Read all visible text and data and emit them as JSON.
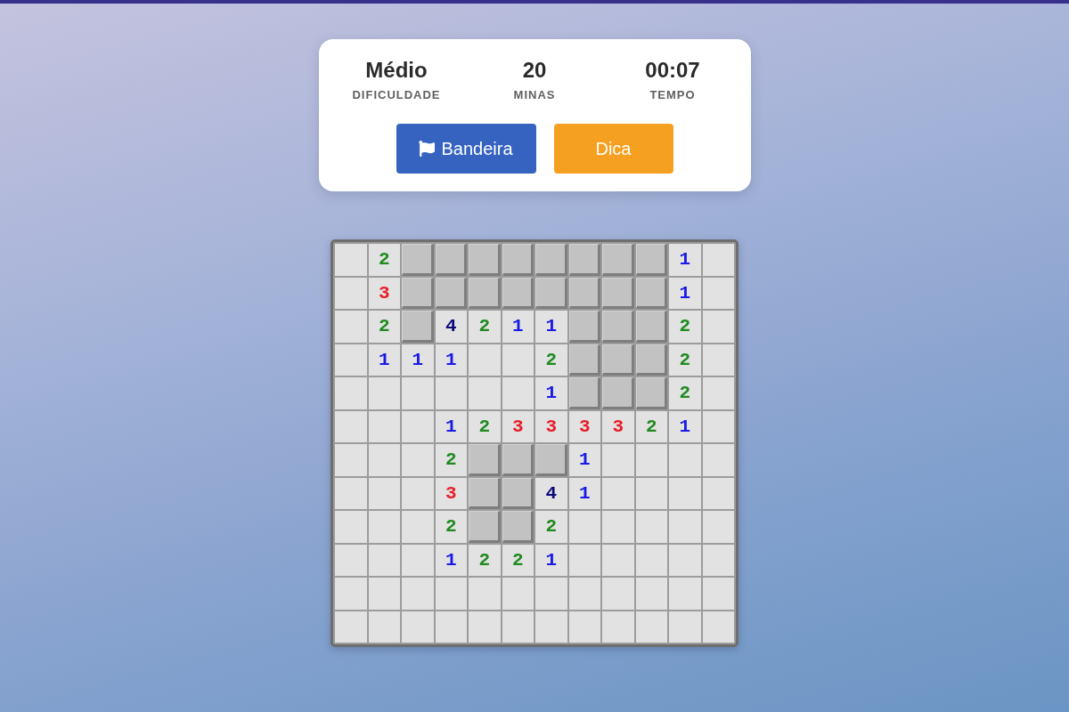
{
  "stats": [
    {
      "value": "Médio",
      "label": "DIFICULDADE"
    },
    {
      "value": "20",
      "label": "MINAS"
    },
    {
      "value": "00:07",
      "label": "TEMPO"
    }
  ],
  "buttons": [
    {
      "kind": "flag",
      "label": "Bandeira"
    },
    {
      "kind": "hint",
      "label": "Dica"
    }
  ],
  "board": {
    "rows": [
      {
        "cells": [
          {
            "kind": "open"
          },
          {
            "kind": "open",
            "number": "2",
            "color": "#1f8a1f"
          },
          {
            "kind": "hidden"
          },
          {
            "kind": "hidden"
          },
          {
            "kind": "hidden"
          },
          {
            "kind": "hidden"
          },
          {
            "kind": "hidden"
          },
          {
            "kind": "hidden"
          },
          {
            "kind": "hidden"
          },
          {
            "kind": "hidden"
          },
          {
            "kind": "open",
            "number": "1",
            "color": "#1a1ae6"
          },
          {
            "kind": "open"
          }
        ]
      },
      {
        "cells": [
          {
            "kind": "open"
          },
          {
            "kind": "open",
            "number": "3",
            "color": "#e81c28"
          },
          {
            "kind": "hidden"
          },
          {
            "kind": "hidden"
          },
          {
            "kind": "hidden"
          },
          {
            "kind": "hidden"
          },
          {
            "kind": "hidden"
          },
          {
            "kind": "hidden"
          },
          {
            "kind": "hidden"
          },
          {
            "kind": "hidden"
          },
          {
            "kind": "open",
            "number": "1",
            "color": "#1a1ae6"
          },
          {
            "kind": "open"
          }
        ]
      },
      {
        "cells": [
          {
            "kind": "open"
          },
          {
            "kind": "open",
            "number": "2",
            "color": "#1f8a1f"
          },
          {
            "kind": "hidden"
          },
          {
            "kind": "open",
            "number": "4",
            "color": "#0a0a78"
          },
          {
            "kind": "open",
            "number": "2",
            "color": "#1f8a1f"
          },
          {
            "kind": "open",
            "number": "1",
            "color": "#1a1ae6"
          },
          {
            "kind": "open",
            "number": "1",
            "color": "#1a1ae6"
          },
          {
            "kind": "hidden"
          },
          {
            "kind": "hidden"
          },
          {
            "kind": "hidden"
          },
          {
            "kind": "open",
            "number": "2",
            "color": "#1f8a1f"
          },
          {
            "kind": "open"
          }
        ]
      },
      {
        "cells": [
          {
            "kind": "open"
          },
          {
            "kind": "open",
            "number": "1",
            "color": "#1a1ae6"
          },
          {
            "kind": "open",
            "number": "1",
            "color": "#1a1ae6"
          },
          {
            "kind": "open",
            "number": "1",
            "color": "#1a1ae6"
          },
          {
            "kind": "open"
          },
          {
            "kind": "open"
          },
          {
            "kind": "open",
            "number": "2",
            "color": "#1f8a1f"
          },
          {
            "kind": "hidden"
          },
          {
            "kind": "hidden"
          },
          {
            "kind": "hidden"
          },
          {
            "kind": "open",
            "number": "2",
            "color": "#1f8a1f"
          },
          {
            "kind": "open"
          }
        ]
      },
      {
        "cells": [
          {
            "kind": "open"
          },
          {
            "kind": "open"
          },
          {
            "kind": "open"
          },
          {
            "kind": "open"
          },
          {
            "kind": "open"
          },
          {
            "kind": "open"
          },
          {
            "kind": "open",
            "number": "1",
            "color": "#1a1ae6"
          },
          {
            "kind": "hidden"
          },
          {
            "kind": "hidden"
          },
          {
            "kind": "hidden"
          },
          {
            "kind": "open",
            "number": "2",
            "color": "#1f8a1f"
          },
          {
            "kind": "open"
          }
        ]
      },
      {
        "cells": [
          {
            "kind": "open"
          },
          {
            "kind": "open"
          },
          {
            "kind": "open"
          },
          {
            "kind": "open",
            "number": "1",
            "color": "#1a1ae6"
          },
          {
            "kind": "open",
            "number": "2",
            "color": "#1f8a1f"
          },
          {
            "kind": "open",
            "number": "3",
            "color": "#e81c28"
          },
          {
            "kind": "open",
            "number": "3",
            "color": "#e81c28"
          },
          {
            "kind": "open",
            "number": "3",
            "color": "#e81c28"
          },
          {
            "kind": "open",
            "number": "3",
            "color": "#e81c28"
          },
          {
            "kind": "open",
            "number": "2",
            "color": "#1f8a1f"
          },
          {
            "kind": "open",
            "number": "1",
            "color": "#1a1ae6"
          },
          {
            "kind": "open"
          }
        ]
      },
      {
        "cells": [
          {
            "kind": "open"
          },
          {
            "kind": "open"
          },
          {
            "kind": "open"
          },
          {
            "kind": "open",
            "number": "2",
            "color": "#1f8a1f"
          },
          {
            "kind": "hidden"
          },
          {
            "kind": "hidden"
          },
          {
            "kind": "hidden"
          },
          {
            "kind": "open",
            "number": "1",
            "color": "#1a1ae6"
          },
          {
            "kind": "open"
          },
          {
            "kind": "open"
          },
          {
            "kind": "open"
          },
          {
            "kind": "open"
          }
        ]
      },
      {
        "cells": [
          {
            "kind": "open"
          },
          {
            "kind": "open"
          },
          {
            "kind": "open"
          },
          {
            "kind": "open",
            "number": "3",
            "color": "#e81c28"
          },
          {
            "kind": "hidden"
          },
          {
            "kind": "hidden"
          },
          {
            "kind": "open",
            "number": "4",
            "color": "#0a0a78"
          },
          {
            "kind": "open",
            "number": "1",
            "color": "#1a1ae6"
          },
          {
            "kind": "open"
          },
          {
            "kind": "open"
          },
          {
            "kind": "open"
          },
          {
            "kind": "open"
          }
        ]
      },
      {
        "cells": [
          {
            "kind": "open"
          },
          {
            "kind": "open"
          },
          {
            "kind": "open"
          },
          {
            "kind": "open",
            "number": "2",
            "color": "#1f8a1f"
          },
          {
            "kind": "hidden"
          },
          {
            "kind": "hidden"
          },
          {
            "kind": "open",
            "number": "2",
            "color": "#1f8a1f"
          },
          {
            "kind": "open"
          },
          {
            "kind": "open"
          },
          {
            "kind": "open"
          },
          {
            "kind": "open"
          },
          {
            "kind": "open"
          }
        ]
      },
      {
        "cells": [
          {
            "kind": "open"
          },
          {
            "kind": "open"
          },
          {
            "kind": "open"
          },
          {
            "kind": "open",
            "number": "1",
            "color": "#1a1ae6"
          },
          {
            "kind": "open",
            "number": "2",
            "color": "#1f8a1f"
          },
          {
            "kind": "open",
            "number": "2",
            "color": "#1f8a1f"
          },
          {
            "kind": "open",
            "number": "1",
            "color": "#1a1ae6"
          },
          {
            "kind": "open"
          },
          {
            "kind": "open"
          },
          {
            "kind": "open"
          },
          {
            "kind": "open"
          },
          {
            "kind": "open"
          }
        ]
      },
      {
        "cells": [
          {
            "kind": "open"
          },
          {
            "kind": "open"
          },
          {
            "kind": "open"
          },
          {
            "kind": "open"
          },
          {
            "kind": "open"
          },
          {
            "kind": "open"
          },
          {
            "kind": "open"
          },
          {
            "kind": "open"
          },
          {
            "kind": "open"
          },
          {
            "kind": "open"
          },
          {
            "kind": "open"
          },
          {
            "kind": "open"
          }
        ]
      },
      {
        "cells": [
          {
            "kind": "open"
          },
          {
            "kind": "open"
          },
          {
            "kind": "open"
          },
          {
            "kind": "open"
          },
          {
            "kind": "open"
          },
          {
            "kind": "open"
          },
          {
            "kind": "open"
          },
          {
            "kind": "open"
          },
          {
            "kind": "open"
          },
          {
            "kind": "open"
          },
          {
            "kind": "open"
          },
          {
            "kind": "open"
          }
        ]
      }
    ]
  }
}
